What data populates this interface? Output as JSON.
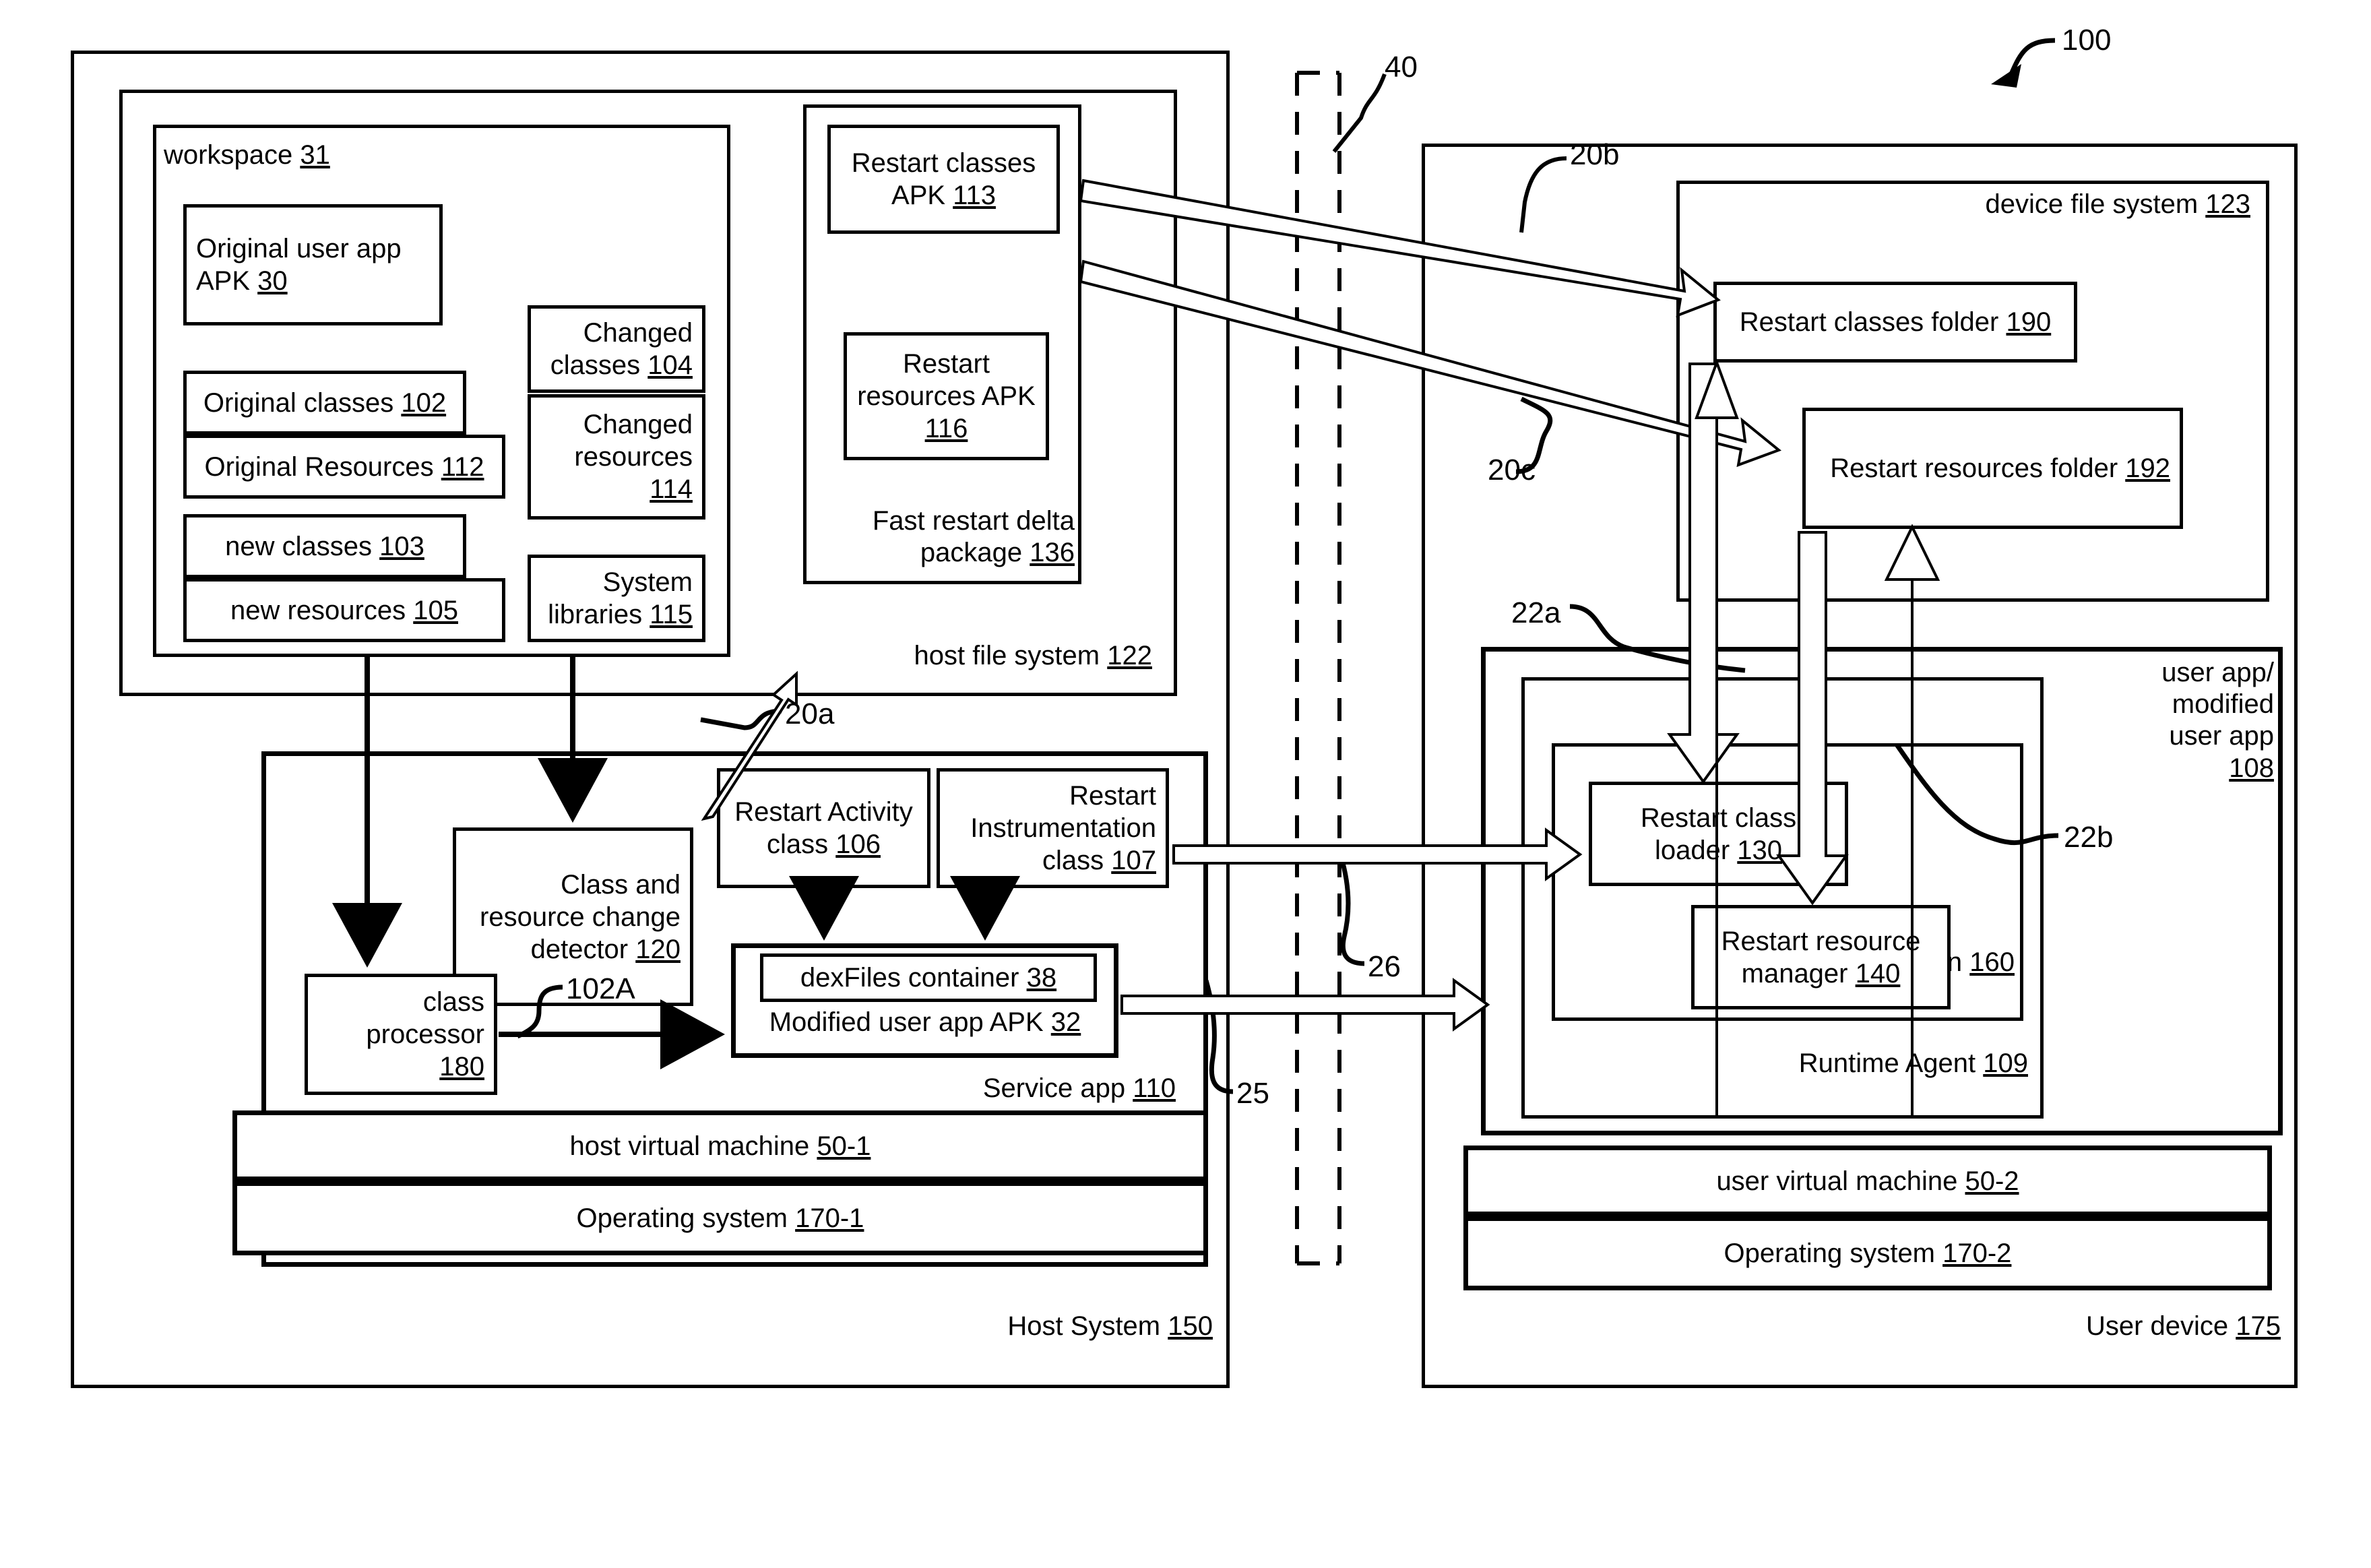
{
  "figure": {
    "figure_ref": "100",
    "callouts": {
      "c40": "40",
      "c20a": "20a",
      "c20b": "20b",
      "c20c": "20c",
      "c22a": "22a",
      "c22b": "22b",
      "c25": "25",
      "c26": "26",
      "c102A": "102A"
    }
  },
  "host_system": {
    "title": "Host System",
    "ref": "150",
    "host_file_system": {
      "title": "host file system",
      "ref": "122",
      "workspace": {
        "title": "workspace",
        "ref": "31",
        "items": [
          {
            "label": "Original user app\nAPK ",
            "ref": "30",
            "align": "left"
          },
          {
            "label": "Original classes ",
            "ref": "102",
            "align": "center"
          },
          {
            "label": "Original Resources ",
            "ref": "112",
            "align": "center"
          },
          {
            "label": "new classes ",
            "ref": "103",
            "align": "center"
          },
          {
            "label": "new resources ",
            "ref": "105",
            "align": "center"
          },
          {
            "label": "Changed\nclasses ",
            "ref": "104",
            "align": "center"
          },
          {
            "label": "Changed\nresources\n",
            "ref": "114",
            "align": "center"
          },
          {
            "label": "System\nlibraries ",
            "ref": "115",
            "align": "center"
          }
        ]
      },
      "delta_package": {
        "title": "Fast restart delta\npackage ",
        "ref": "136",
        "items": [
          {
            "label": "Restart classes\nAPK ",
            "ref": "113"
          },
          {
            "label": "Restart\nresources\nAPK ",
            "ref": "116"
          }
        ]
      }
    },
    "service_app": {
      "title": "Service app ",
      "ref": "110",
      "change_detector": {
        "label": "Class and\nresource change\ndetector ",
        "ref": "120"
      },
      "class_processor": {
        "label": "class\nprocessor ",
        "ref": "180"
      },
      "restart_activity": {
        "label": "Restart Activity\nclass ",
        "ref": "106"
      },
      "restart_instrumentation": {
        "label": "Restart\nInstrumentation\nclass  ",
        "ref": "107"
      },
      "modified_apk": {
        "label": "Modified user app APK ",
        "ref": "32"
      },
      "dexfiles": {
        "label": "dexFiles container ",
        "ref": "38"
      }
    },
    "host_vm": {
      "label": "host virtual machine ",
      "ref": "50-1"
    },
    "host_os": {
      "label": "Operating system ",
      "ref": "170-1"
    }
  },
  "user_device": {
    "title": "User device ",
    "ref": "175",
    "device_file_system": {
      "title": "device file system ",
      "ref": "123",
      "restart_classes_folder": {
        "label": "Restart classes folder ",
        "ref": "190"
      },
      "restart_resources_folder": {
        "label": "Restart resources folder\n",
        "ref": "192"
      }
    },
    "user_app": {
      "title": "user app/\nmodified\nuser app\n",
      "ref": "108",
      "runtime_agent": {
        "label": "Runtime Agent ",
        "ref": "109"
      },
      "loader_integration": {
        "label": "Loader integration ",
        "ref": "160"
      },
      "restart_class_loader": {
        "label": "Restart class\nloader ",
        "ref": "130"
      },
      "restart_resource_manager": {
        "label": "Restart resource\nmanager ",
        "ref": "140"
      }
    },
    "user_vm": {
      "label": "user virtual machine ",
      "ref": "50-2"
    },
    "user_os": {
      "label": "Operating system ",
      "ref": "170-2"
    }
  }
}
